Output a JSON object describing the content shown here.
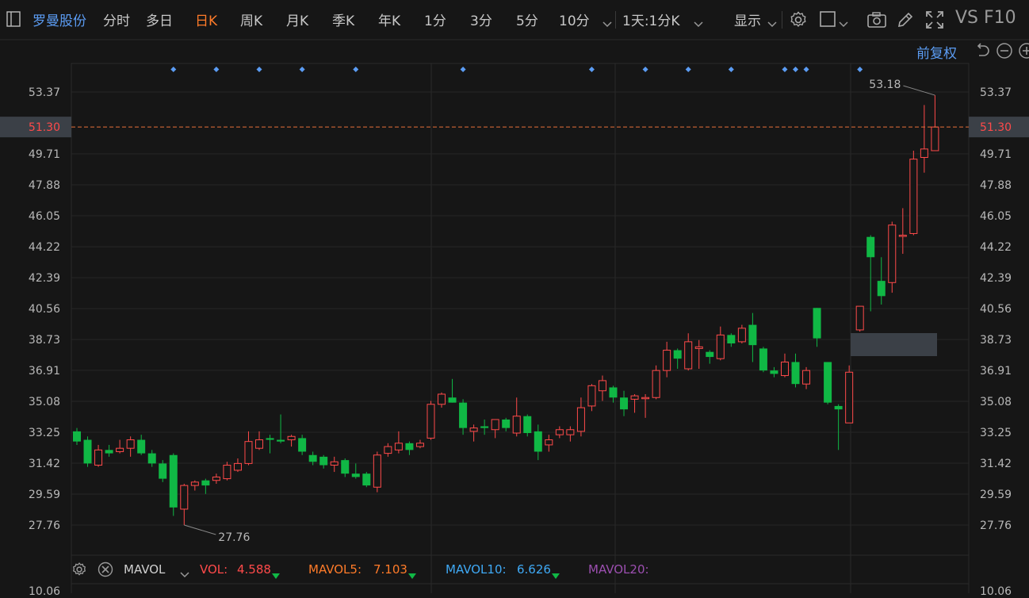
{
  "toolbar": {
    "stock_name": "罗曼股份",
    "periods": [
      {
        "label": "分时",
        "active": false
      },
      {
        "label": "多日",
        "active": false
      },
      {
        "label": "日K",
        "active": true
      },
      {
        "label": "周K",
        "active": false
      },
      {
        "label": "月K",
        "active": false
      },
      {
        "label": "季K",
        "active": false
      },
      {
        "label": "年K",
        "active": false
      },
      {
        "label": "1分",
        "active": false
      },
      {
        "label": "3分",
        "active": false
      },
      {
        "label": "5分",
        "active": false
      },
      {
        "label": "10分",
        "active": false
      }
    ],
    "range_label": "1天:1分K",
    "display_label": "显示",
    "vs_label": "VS",
    "f10_label": "F10"
  },
  "chart_header": {
    "adjust_label": "前复权"
  },
  "y_axis": {
    "ticks": [
      "53.37",
      "51.30",
      "49.71",
      "47.88",
      "46.05",
      "44.22",
      "42.39",
      "40.56",
      "38.73",
      "36.91",
      "35.08",
      "33.25",
      "31.42",
      "29.59",
      "27.76"
    ]
  },
  "annotations": {
    "high_label": "53.18",
    "low_label": "27.76",
    "current_price": "51.30"
  },
  "volume_bar": {
    "indicator": "MAVOL",
    "vol_label": "VOL:",
    "vol_value": "4.588",
    "mavol5_label": "MAVOL5:",
    "mavol5_value": "7.103",
    "mavol10_label": "MAVOL10:",
    "mavol10_value": "6.626",
    "mavol20_label": "MAVOL20:",
    "vol_axis_value": "10.06"
  },
  "colors": {
    "up": "#ff4a4a",
    "down": "#10b845",
    "accent": "#ff7b29",
    "blue": "#5b9cf3",
    "mavol10": "#3fa9f5",
    "mavol20": "#9c4fb0"
  },
  "chart_data": {
    "type": "candlestick",
    "y_range": [
      26.5,
      54.5
    ],
    "marker_columns": [
      9,
      13,
      17,
      21,
      26,
      36,
      48,
      53,
      57,
      61,
      66,
      67,
      68,
      73
    ],
    "candles": [
      {
        "o": 33.3,
        "h": 33.5,
        "l": 32.5,
        "c": 32.7
      },
      {
        "o": 32.8,
        "h": 33.0,
        "l": 31.2,
        "c": 31.4
      },
      {
        "o": 31.3,
        "h": 32.5,
        "l": 31.2,
        "c": 32.2
      },
      {
        "o": 32.2,
        "h": 32.5,
        "l": 31.8,
        "c": 32.0
      },
      {
        "o": 32.1,
        "h": 32.8,
        "l": 32.0,
        "c": 32.3
      },
      {
        "o": 32.3,
        "h": 33.0,
        "l": 31.8,
        "c": 32.8
      },
      {
        "o": 32.8,
        "h": 33.1,
        "l": 31.9,
        "c": 32.0
      },
      {
        "o": 32.0,
        "h": 32.2,
        "l": 31.2,
        "c": 31.4
      },
      {
        "o": 31.4,
        "h": 31.6,
        "l": 30.3,
        "c": 30.5
      },
      {
        "o": 31.9,
        "h": 32.0,
        "l": 28.3,
        "c": 28.8
      },
      {
        "o": 28.7,
        "h": 30.2,
        "l": 27.76,
        "c": 30.1
      },
      {
        "o": 30.1,
        "h": 30.4,
        "l": 29.8,
        "c": 30.3
      },
      {
        "o": 30.4,
        "h": 30.5,
        "l": 29.6,
        "c": 30.1
      },
      {
        "o": 30.4,
        "h": 30.8,
        "l": 30.2,
        "c": 30.6
      },
      {
        "o": 30.5,
        "h": 31.5,
        "l": 30.4,
        "c": 31.3
      },
      {
        "o": 31.0,
        "h": 31.7,
        "l": 30.9,
        "c": 31.4
      },
      {
        "o": 31.4,
        "h": 33.3,
        "l": 31.3,
        "c": 32.7
      },
      {
        "o": 32.3,
        "h": 33.3,
        "l": 32.2,
        "c": 32.8
      },
      {
        "o": 32.9,
        "h": 33.1,
        "l": 32.0,
        "c": 32.8
      },
      {
        "o": 32.8,
        "h": 34.3,
        "l": 32.6,
        "c": 32.7
      },
      {
        "o": 32.8,
        "h": 33.1,
        "l": 32.4,
        "c": 33.0
      },
      {
        "o": 32.9,
        "h": 33.1,
        "l": 31.9,
        "c": 32.1
      },
      {
        "o": 31.9,
        "h": 32.1,
        "l": 31.3,
        "c": 31.5
      },
      {
        "o": 31.8,
        "h": 31.9,
        "l": 31.1,
        "c": 31.3
      },
      {
        "o": 31.3,
        "h": 31.8,
        "l": 30.9,
        "c": 31.5
      },
      {
        "o": 31.6,
        "h": 31.7,
        "l": 30.6,
        "c": 30.8
      },
      {
        "o": 30.8,
        "h": 31.4,
        "l": 30.5,
        "c": 30.6
      },
      {
        "o": 30.8,
        "h": 30.9,
        "l": 30.0,
        "c": 30.1
      },
      {
        "o": 30.0,
        "h": 32.1,
        "l": 29.7,
        "c": 31.9
      },
      {
        "o": 32.0,
        "h": 32.6,
        "l": 31.8,
        "c": 32.4
      },
      {
        "o": 32.2,
        "h": 33.3,
        "l": 32.0,
        "c": 32.6
      },
      {
        "o": 32.6,
        "h": 32.7,
        "l": 31.9,
        "c": 32.2
      },
      {
        "o": 32.4,
        "h": 32.8,
        "l": 32.3,
        "c": 32.6
      },
      {
        "o": 32.9,
        "h": 35.1,
        "l": 32.8,
        "c": 34.9
      },
      {
        "o": 34.9,
        "h": 35.6,
        "l": 34.7,
        "c": 35.5
      },
      {
        "o": 35.3,
        "h": 36.4,
        "l": 35.0,
        "c": 35.0
      },
      {
        "o": 35.0,
        "h": 35.2,
        "l": 33.1,
        "c": 33.5
      },
      {
        "o": 33.3,
        "h": 33.7,
        "l": 32.7,
        "c": 33.5
      },
      {
        "o": 33.6,
        "h": 34.0,
        "l": 33.1,
        "c": 33.5
      },
      {
        "o": 33.4,
        "h": 34.0,
        "l": 32.9,
        "c": 34.0
      },
      {
        "o": 34.0,
        "h": 34.1,
        "l": 33.3,
        "c": 33.5
      },
      {
        "o": 33.2,
        "h": 35.3,
        "l": 33.0,
        "c": 34.2
      },
      {
        "o": 34.2,
        "h": 34.3,
        "l": 33.0,
        "c": 33.2
      },
      {
        "o": 33.3,
        "h": 33.7,
        "l": 31.6,
        "c": 32.1
      },
      {
        "o": 32.5,
        "h": 33.1,
        "l": 32.1,
        "c": 32.8
      },
      {
        "o": 33.1,
        "h": 33.6,
        "l": 32.9,
        "c": 33.4
      },
      {
        "o": 33.1,
        "h": 33.6,
        "l": 32.7,
        "c": 33.4
      },
      {
        "o": 33.3,
        "h": 35.3,
        "l": 33.0,
        "c": 34.7
      },
      {
        "o": 34.8,
        "h": 36.1,
        "l": 34.5,
        "c": 36.0
      },
      {
        "o": 35.7,
        "h": 36.6,
        "l": 35.1,
        "c": 36.3
      },
      {
        "o": 35.9,
        "h": 36.0,
        "l": 35.0,
        "c": 35.3
      },
      {
        "o": 35.3,
        "h": 35.7,
        "l": 34.2,
        "c": 34.6
      },
      {
        "o": 35.2,
        "h": 35.5,
        "l": 34.4,
        "c": 35.4
      },
      {
        "o": 35.3,
        "h": 35.5,
        "l": 34.1,
        "c": 35.3
      },
      {
        "o": 35.3,
        "h": 37.2,
        "l": 35.2,
        "c": 36.9
      },
      {
        "o": 36.9,
        "h": 38.6,
        "l": 36.5,
        "c": 38.1
      },
      {
        "o": 38.1,
        "h": 38.2,
        "l": 37.0,
        "c": 37.6
      },
      {
        "o": 37.0,
        "h": 39.1,
        "l": 36.9,
        "c": 38.6
      },
      {
        "o": 38.2,
        "h": 38.7,
        "l": 37.0,
        "c": 38.3
      },
      {
        "o": 38.0,
        "h": 38.1,
        "l": 37.3,
        "c": 37.7
      },
      {
        "o": 37.6,
        "h": 39.5,
        "l": 37.5,
        "c": 39.0
      },
      {
        "o": 39.0,
        "h": 39.1,
        "l": 38.3,
        "c": 38.5
      },
      {
        "o": 38.6,
        "h": 39.6,
        "l": 38.5,
        "c": 39.4
      },
      {
        "o": 39.6,
        "h": 40.3,
        "l": 37.4,
        "c": 38.4
      },
      {
        "o": 38.2,
        "h": 38.3,
        "l": 36.8,
        "c": 36.9
      },
      {
        "o": 36.9,
        "h": 37.1,
        "l": 36.5,
        "c": 36.7
      },
      {
        "o": 36.6,
        "h": 37.9,
        "l": 36.5,
        "c": 37.4
      },
      {
        "o": 37.4,
        "h": 37.9,
        "l": 35.9,
        "c": 36.1
      },
      {
        "o": 36.1,
        "h": 37.1,
        "l": 35.8,
        "c": 36.9
      },
      {
        "o": 40.6,
        "h": 40.6,
        "l": 38.3,
        "c": 38.8
      },
      {
        "o": 37.4,
        "h": 37.4,
        "l": 34.9,
        "c": 35.0
      },
      {
        "o": 34.8,
        "h": 34.9,
        "l": 32.2,
        "c": 34.6
      },
      {
        "o": 33.8,
        "h": 37.2,
        "l": 33.8,
        "c": 36.8
      },
      {
        "o": 39.3,
        "h": 40.5,
        "l": 39.2,
        "c": 40.7
      },
      {
        "o": 44.8,
        "h": 44.9,
        "l": 40.4,
        "c": 43.6
      },
      {
        "o": 42.2,
        "h": 43.6,
        "l": 40.8,
        "c": 41.3
      },
      {
        "o": 42.1,
        "h": 45.7,
        "l": 41.5,
        "c": 45.5
      },
      {
        "o": 44.9,
        "h": 46.5,
        "l": 43.8,
        "c": 44.9
      },
      {
        "o": 45.0,
        "h": 49.9,
        "l": 44.9,
        "c": 49.4
      },
      {
        "o": 49.5,
        "h": 52.6,
        "l": 48.6,
        "c": 50.0
      },
      {
        "o": 49.9,
        "h": 53.18,
        "l": 49.9,
        "c": 51.3
      }
    ]
  }
}
